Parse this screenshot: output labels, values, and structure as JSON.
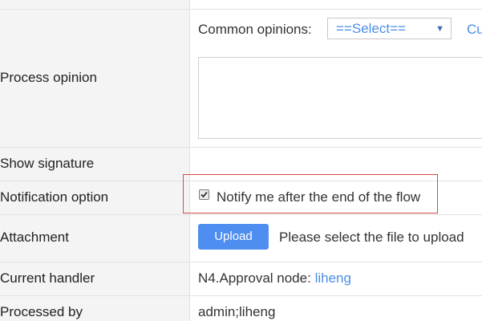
{
  "form": {
    "common_opinions": {
      "label": "Common opinions:",
      "select_value": "==Select==",
      "link_text": "Cu"
    },
    "rows": {
      "process_opinion": {
        "label": "Process opinion",
        "textarea_value": ""
      },
      "show_signature": {
        "label": "Show signature"
      },
      "notification_option": {
        "label": "Notification option",
        "checkbox_checked": true,
        "checkbox_text": "Notify me after the end of the flow"
      },
      "attachment": {
        "label": "Attachment",
        "upload_button": "Upload",
        "hint": "Please select the file to upload"
      },
      "current_handler": {
        "label": "Current handler",
        "node_text": "N4.Approval node:",
        "handler_link": "liheng"
      },
      "processed_by": {
        "label": "Processed by",
        "value": "admin;liheng"
      }
    }
  },
  "colors": {
    "link": "#4a8ee8",
    "button": "#4d8ef0",
    "highlight_border": "#d94a4a",
    "label_background": "#f4f4f4"
  },
  "icons": {
    "select_arrow": "caret-down-icon",
    "checkbox": "checkmark-icon"
  }
}
